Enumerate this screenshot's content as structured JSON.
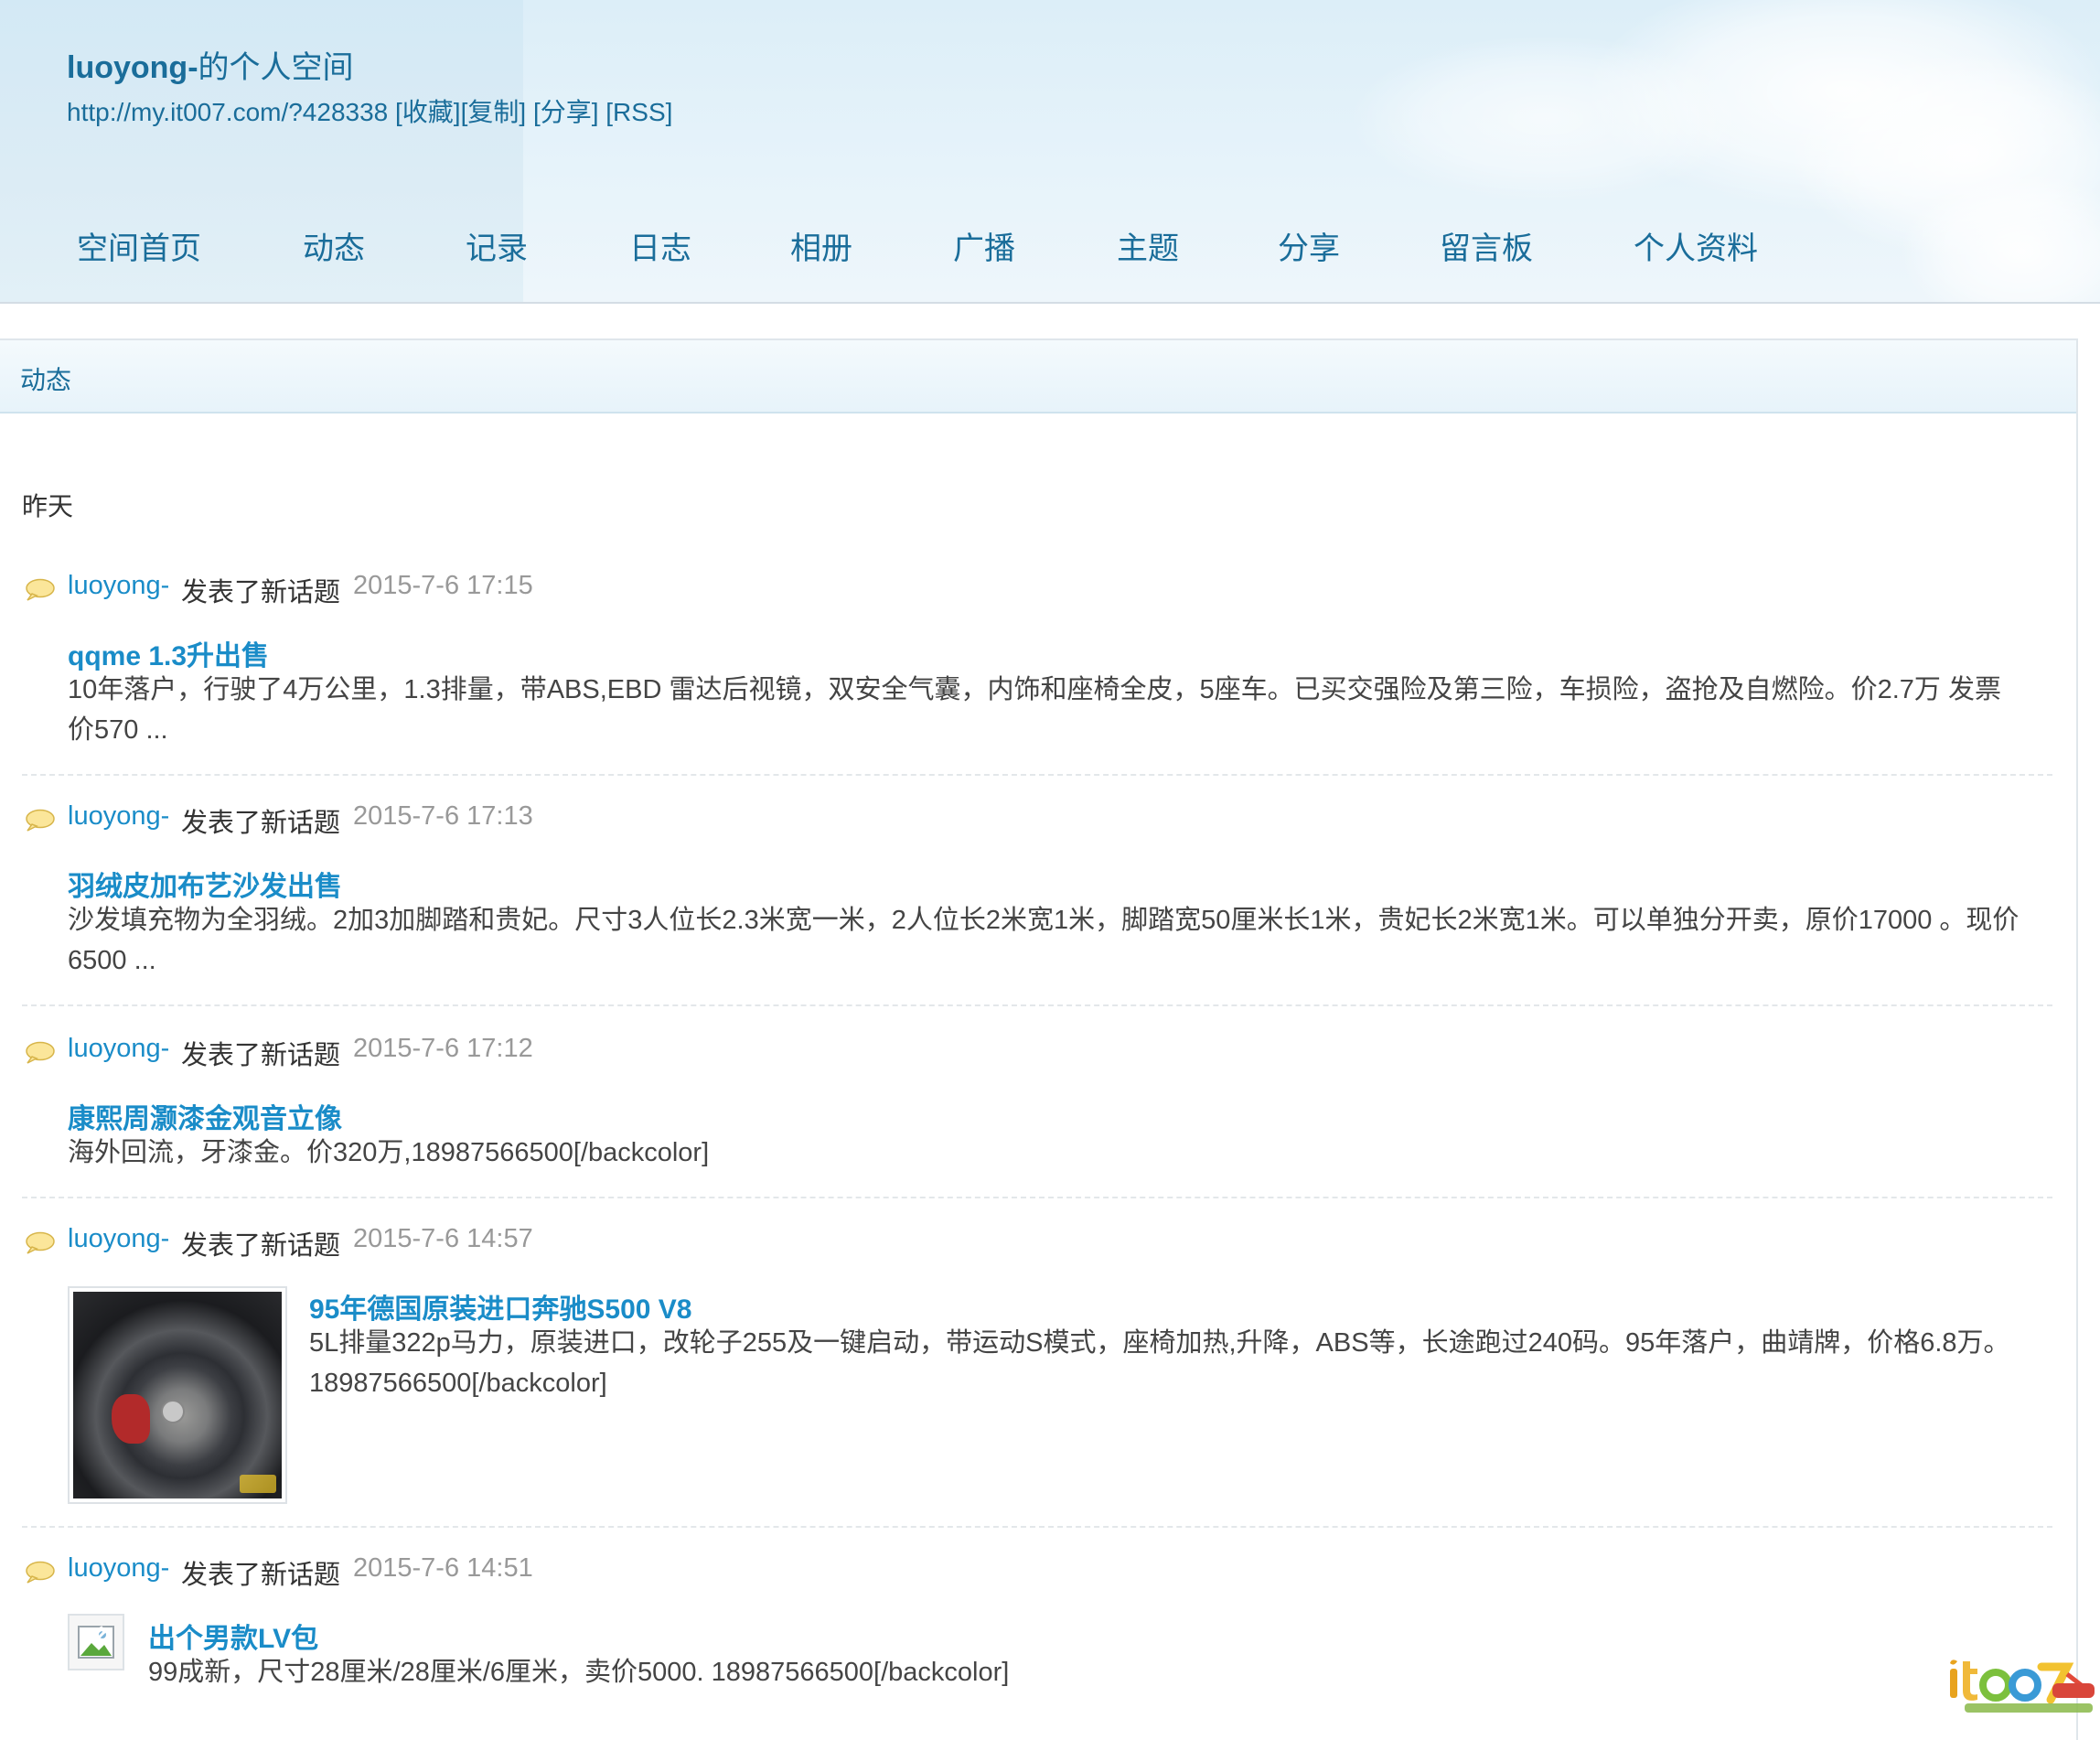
{
  "header": {
    "title_user": "luoyong-",
    "title_suffix": "的个人空间",
    "url": "http://my.it007.com/?428338",
    "links": [
      "[收藏]",
      "[复制]",
      "[分享]",
      "[RSS]"
    ]
  },
  "nav": [
    "空间首页",
    "动态",
    "记录",
    "日志",
    "相册",
    "广播",
    "主题",
    "分享",
    "留言板",
    "个人资料"
  ],
  "panel": {
    "title": "动态",
    "day_label": "昨天"
  },
  "feed": [
    {
      "author": "luoyong-",
      "action": "发表了新话题",
      "time": "2015-7-6 17:15",
      "topic": "qqme 1.3升出售",
      "desc": "10年落户，行驶了4万公里，1.3排量，带ABS,EBD 雷达后视镜，双安全气囊，内饰和座椅全皮，5座车。已买交强险及第三险，车损险，盗抢及自燃险。价2.7万 发票价570 ..."
    },
    {
      "author": "luoyong-",
      "action": "发表了新话题",
      "time": "2015-7-6 17:13",
      "topic": "羽绒皮加布艺沙发出售",
      "desc": "沙发填充物为全羽绒。2加3加脚踏和贵妃。尺寸3人位长2.3米宽一米，2人位长2米宽1米，脚踏宽50厘米长1米，贵妃长2米宽1米。可以单独分开卖，原价17000 。现价6500 ..."
    },
    {
      "author": "luoyong-",
      "action": "发表了新话题",
      "time": "2015-7-6 17:12",
      "topic": "康熙周灏漆金观音立像",
      "desc": "海外回流，牙漆金。价320万,18987566500[/backcolor]"
    },
    {
      "author": "luoyong-",
      "action": "发表了新话题",
      "time": "2015-7-6 14:57",
      "topic": "95年德国原装进口奔驰S500 V8",
      "desc": "5L排量322p马力，原装进口，改轮子255及一键启动，带运动S模式，座椅加热,升降，ABS等，长途跑过240码。95年落户，曲靖牌，价格6.8万。18987566500[/backcolor]"
    },
    {
      "author": "luoyong-",
      "action": "发表了新话题",
      "time": "2015-7-6 14:51",
      "topic": "出个男款LV包",
      "desc": "99成新，尺寸28厘米/28厘米/6厘米，卖价5000. 18987566500[/backcolor]"
    }
  ],
  "colors": {
    "link": "#1a8cc8",
    "header_link": "#1a6d9a",
    "time": "#999999"
  }
}
